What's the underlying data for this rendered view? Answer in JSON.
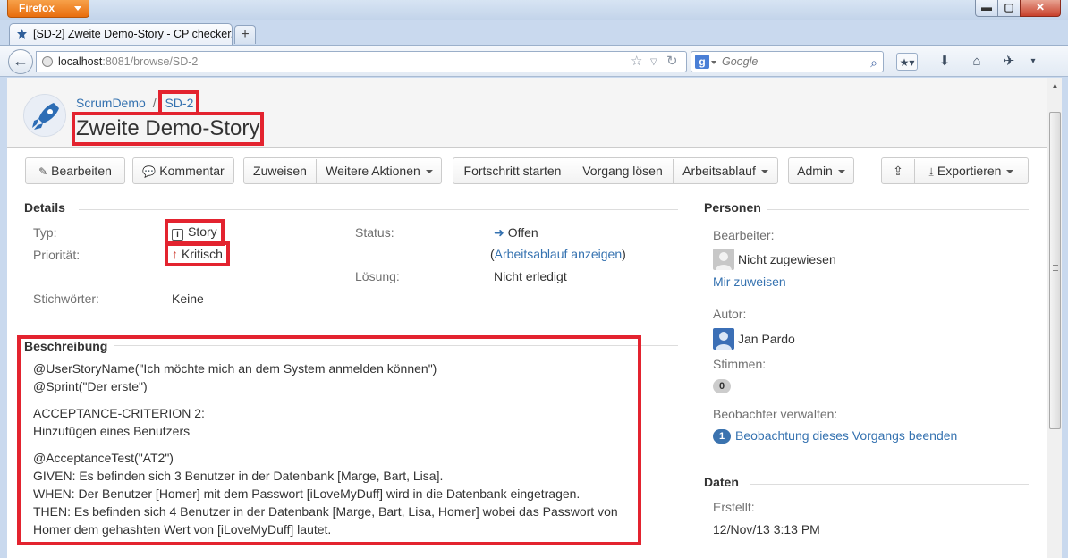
{
  "browser": {
    "app_button": "Firefox",
    "tab_title": "[SD-2] Zweite Demo-Story - CP checker...",
    "url_host": "localhost",
    "url_rest": ":8081/browse/SD-2",
    "search_placeholder": "Google",
    "window_controls": {
      "minimize": "▬",
      "maximize": "▢",
      "close": "✕"
    }
  },
  "issue": {
    "project": "ScrumDemo",
    "separator": "/",
    "key": "SD-2",
    "summary": "Zweite Demo-Story"
  },
  "toolbar": {
    "edit": "Bearbeiten",
    "comment": "Kommentar",
    "assign": "Zuweisen",
    "more_actions": "Weitere Aktionen",
    "start_progress": "Fortschritt starten",
    "resolve": "Vorgang lösen",
    "workflow": "Arbeitsablauf",
    "admin": "Admin",
    "export": "Exportieren"
  },
  "details": {
    "title": "Details",
    "type_label": "Typ:",
    "type_value": "Story",
    "priority_label": "Priorität:",
    "priority_value": "Kritisch",
    "labels_label": "Stichwörter:",
    "labels_value": "Keine",
    "status_label": "Status:",
    "status_value": "Offen",
    "view_workflow_open": "(",
    "view_workflow": "Arbeitsablauf anzeigen",
    "view_workflow_close": ")",
    "resolution_label": "Lösung:",
    "resolution_value": "Nicht erledigt"
  },
  "description": {
    "title": "Beschreibung",
    "lines": [
      "@UserStoryName(\"Ich möchte mich an dem System anmelden können\")",
      "@Sprint(\"Der erste\")",
      "ACCEPTANCE-CRITERION 2:",
      "Hinzufügen eines Benutzers",
      "@AcceptanceTest(\"AT2\")",
      "GIVEN: Es befinden sich 3 Benutzer in der Datenbank [Marge, Bart, Lisa].",
      "WHEN: Der Benutzer [Homer] mit dem Passwort [iLoveMyDuff] wird in die Datenbank eingetragen.",
      "THEN: Es befinden sich 4 Benutzer in der Datenbank [Marge, Bart, Lisa, Homer] wobei das Passwort von",
      "Homer dem gehashten Wert von [iLoveMyDuff] lautet."
    ]
  },
  "people": {
    "title": "Personen",
    "assignee_label": "Bearbeiter:",
    "assignee_value": "Nicht zugewiesen",
    "assign_to_me": "Mir zuweisen",
    "reporter_label": "Autor:",
    "reporter_value": "Jan Pardo",
    "votes_label": "Stimmen:",
    "votes_count": "0",
    "watchers_label": "Beobachter verwalten:",
    "watchers_count": "1",
    "stop_watching": "Beobachtung dieses Vorgangs beenden"
  },
  "dates": {
    "title": "Daten",
    "created_label": "Erstellt:",
    "created_value": "12/Nov/13 3:13 PM"
  },
  "colors": {
    "highlight": "#e3232f",
    "link": "#3572b0",
    "firefox_orange": "#e86d0d"
  }
}
